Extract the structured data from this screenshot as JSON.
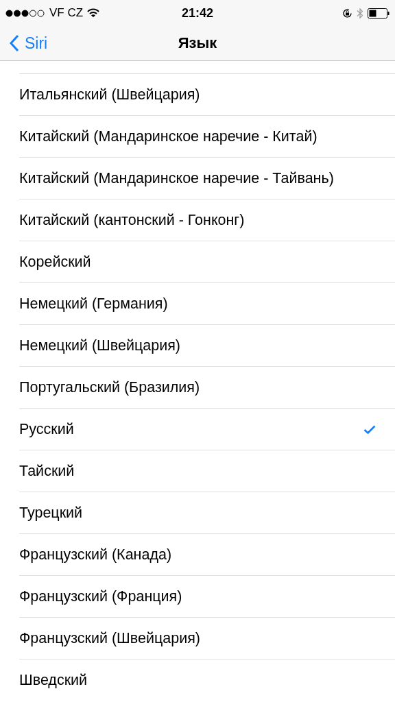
{
  "status_bar": {
    "carrier": "VF CZ",
    "time": "21:42"
  },
  "nav": {
    "back": "Siri",
    "title": "Язык"
  },
  "languages": [
    {
      "label": "Итальянский (Швейцария)",
      "selected": false
    },
    {
      "label": "Китайский (Мандаринское наречие - Китай)",
      "selected": false
    },
    {
      "label": "Китайский (Мандаринское наречие - Тайвань)",
      "selected": false
    },
    {
      "label": "Китайский (кантонский - Гонконг)",
      "selected": false
    },
    {
      "label": "Корейский",
      "selected": false
    },
    {
      "label": "Немецкий (Германия)",
      "selected": false
    },
    {
      "label": "Немецкий (Швейцария)",
      "selected": false
    },
    {
      "label": "Португальский (Бразилия)",
      "selected": false
    },
    {
      "label": "Русский",
      "selected": true
    },
    {
      "label": "Тайский",
      "selected": false
    },
    {
      "label": "Турецкий",
      "selected": false
    },
    {
      "label": "Французский (Канада)",
      "selected": false
    },
    {
      "label": "Французский (Франция)",
      "selected": false
    },
    {
      "label": "Французский (Швейцария)",
      "selected": false
    },
    {
      "label": "Шведский",
      "selected": false
    }
  ]
}
